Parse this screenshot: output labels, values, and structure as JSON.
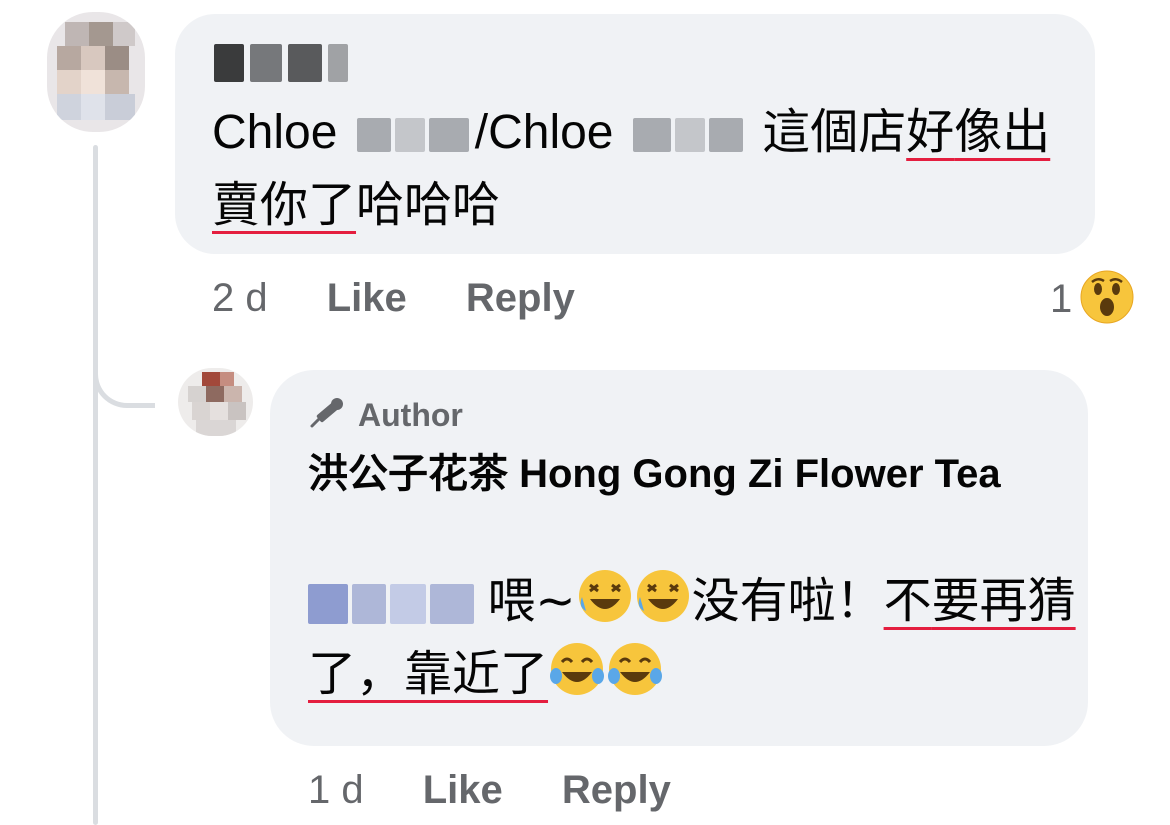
{
  "comment": {
    "text_start": "Chloe ",
    "text_mid": "/Chloe ",
    "text_cn_plain": "這個店",
    "text_cn_u1": "好",
    "text_cn_u2": "像出賣你了",
    "text_cn_tail": "哈哈哈",
    "time": "2 d",
    "like_label": "Like",
    "reply_label": "Reply",
    "reaction_count": "1",
    "reaction_icon": "wow-emoji-icon"
  },
  "reply": {
    "badge_label": "Author",
    "badge_icon": "microphone-icon",
    "page_name": "洪公子花茶 Hong Gong Zi Flower Tea",
    "text_a": "喂~",
    "text_b": "没有啦！",
    "text_u1": "不",
    "text_u2": "要再猜了，靠近了",
    "emoji_1": "rolling-laughing-emoji-icon",
    "emoji_2": "tears-of-joy-emoji-icon",
    "time": "1 d",
    "like_label": "Like",
    "reply_label": "Reply"
  },
  "colors": {
    "bubble": "#f0f2f5",
    "meta_text": "#65676b",
    "spell_underline": "#e41e3f",
    "mention_blur": "#aeb7d8",
    "emoji_yellow": "#f7c53c"
  }
}
